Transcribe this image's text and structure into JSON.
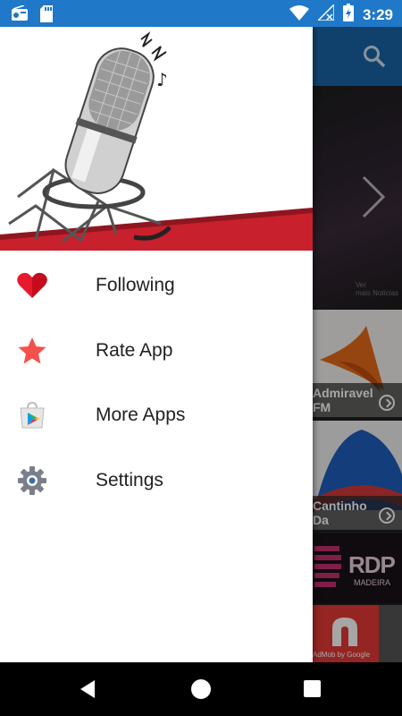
{
  "status_bar": {
    "time": "3:29",
    "icons": [
      "radio-icon",
      "sd-card-icon",
      "wifi-icon",
      "no-signal-icon",
      "battery-icon"
    ]
  },
  "drawer": {
    "header_image": "microphone-illustration",
    "items": [
      {
        "label": "Following",
        "icon": "heart-icon"
      },
      {
        "label": "Rate App",
        "icon": "star-icon"
      },
      {
        "label": "More Apps",
        "icon": "play-store-icon"
      },
      {
        "label": "Settings",
        "icon": "gear-icon"
      }
    ]
  },
  "background": {
    "toolbar_icon": "search-icon",
    "hero_caption": [
      "Ver",
      "mais Notícias"
    ],
    "stations": [
      {
        "name_line1": "Admiravel",
        "name_line2": "FM"
      },
      {
        "name_line1": "Cantinho",
        "name_line2": "Da"
      },
      {
        "name_line1": "RDP",
        "name_line2": "MADEIRA"
      }
    ],
    "ad_text": "AdMob by Google"
  },
  "colors": {
    "status_bar": "#1f78c8",
    "toolbar": "#1965a6",
    "heart": "#e8192c",
    "star": "#f4514b",
    "gear": "#7a7f8a"
  }
}
